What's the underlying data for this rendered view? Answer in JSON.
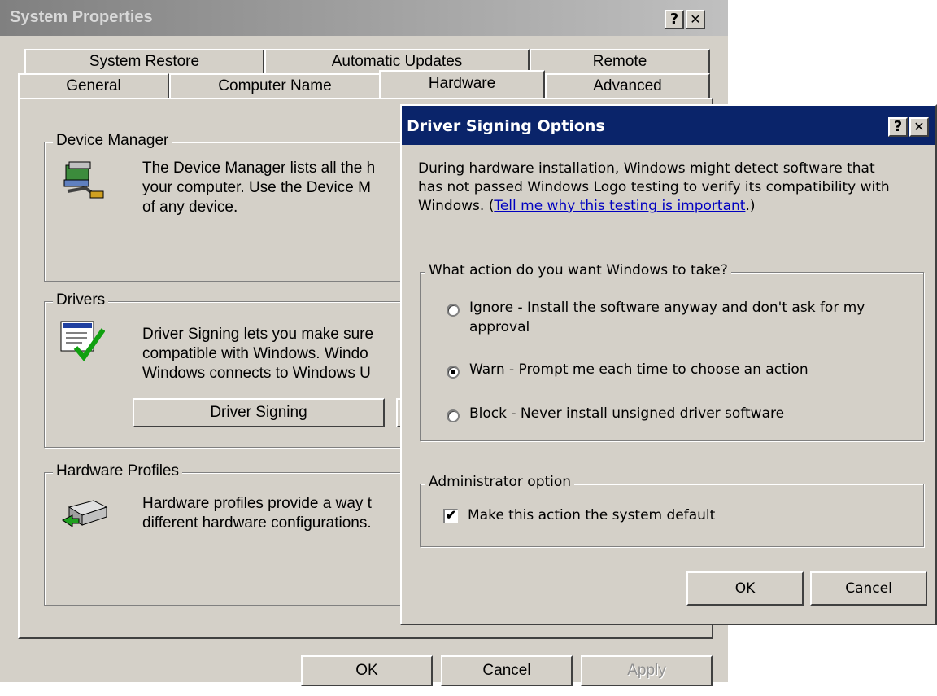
{
  "system_properties": {
    "title": "System Properties",
    "help_btn": "?",
    "close_btn": "✕",
    "tabs_back": [
      "System Restore",
      "Automatic Updates",
      "Remote"
    ],
    "tabs_front": [
      "General",
      "Computer Name",
      "Hardware",
      "Advanced"
    ],
    "active_tab": "Hardware",
    "device_manager": {
      "title": "Device Manager",
      "lines": [
        "The Device Manager lists all the h",
        "your computer. Use the Device M",
        "of any device."
      ]
    },
    "drivers": {
      "title": "Drivers",
      "lines": [
        "Driver Signing lets you make sure",
        "compatible with Windows. Windo",
        "Windows connects to Windows U"
      ],
      "driver_signing_button": "Driver Signing"
    },
    "hardware_profiles": {
      "title": "Hardware Profiles",
      "lines": [
        "Hardware profiles provide a way t",
        "different hardware configurations."
      ]
    },
    "buttons": {
      "ok": "OK",
      "cancel": "Cancel",
      "apply": "Apply"
    }
  },
  "driver_signing_options": {
    "title": "Driver Signing Options",
    "help_btn": "?",
    "close_btn": "✕",
    "intro_lines": [
      "During hardware installation, Windows might detect software that",
      "has not passed Windows Logo testing to verify its compatibility with"
    ],
    "intro_prefix": "Windows. (",
    "intro_link": "Tell me why this testing is important",
    "intro_suffix": ".)",
    "action_group": {
      "title": "What action do you want Windows to take?",
      "options": [
        {
          "line1": "Ignore - Install the software anyway and don't ask for my",
          "line2": "approval",
          "selected": false
        },
        {
          "line1": "Warn - Prompt me each time to choose an action",
          "selected": true
        },
        {
          "line1": "Block - Never install unsigned driver software",
          "selected": false
        }
      ]
    },
    "admin_group": {
      "title": "Administrator option",
      "checkbox_label": "Make this action the system default",
      "checked": true,
      "check_mark": "✔"
    },
    "buttons": {
      "ok": "OK",
      "cancel": "Cancel"
    }
  }
}
